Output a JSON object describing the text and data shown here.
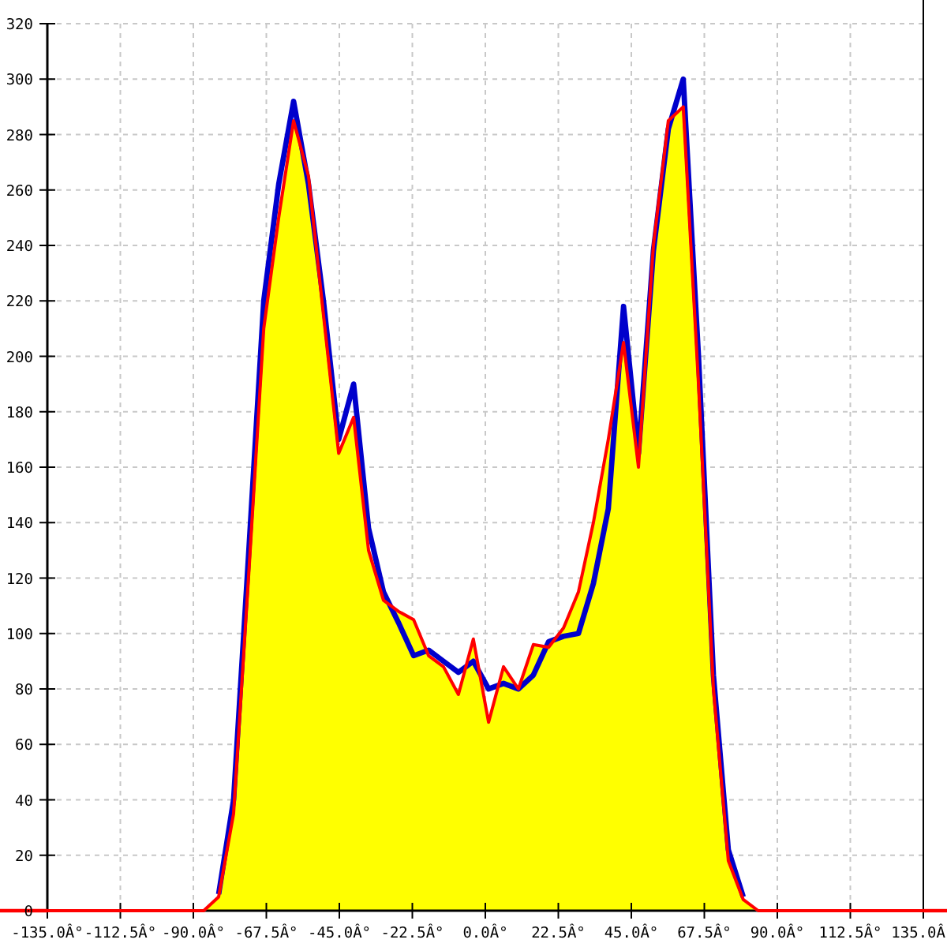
{
  "chart_data": {
    "type": "line",
    "grid": true,
    "xlim": [
      -135,
      135
    ],
    "ylim": [
      0,
      320
    ],
    "xticks": [
      {
        "value": -135,
        "label": "-135.0Â°"
      },
      {
        "value": -112.5,
        "label": "-112.5Â°"
      },
      {
        "value": -90,
        "label": "-90.0Â°"
      },
      {
        "value": -67.5,
        "label": "-67.5Â°"
      },
      {
        "value": -45,
        "label": "-45.0Â°"
      },
      {
        "value": -22.5,
        "label": "-22.5Â°"
      },
      {
        "value": 0,
        "label": "0.0Â°"
      },
      {
        "value": 22.5,
        "label": "22.5Â°"
      },
      {
        "value": 45,
        "label": "45.0Â°"
      },
      {
        "value": 67.5,
        "label": "67.5Â°"
      },
      {
        "value": 90,
        "label": "90.0Â°"
      },
      {
        "value": 112.5,
        "label": "112.5Â°"
      },
      {
        "value": 135,
        "label": "135.0Â"
      }
    ],
    "yticks": [
      0,
      20,
      40,
      60,
      80,
      100,
      120,
      140,
      160,
      180,
      200,
      220,
      240,
      260,
      280,
      300,
      320
    ],
    "x": [
      -135,
      -96.1,
      -91.4,
      -86.8,
      -82.2,
      -77.6,
      -73,
      -68.3,
      -63.7,
      -59.1,
      -54.5,
      -49.9,
      -45.2,
      -40.6,
      -36,
      -31.4,
      -26.8,
      -22.1,
      -17.5,
      -12.9,
      -8.3,
      -3.7,
      1,
      5.6,
      10.2,
      14.8,
      19.5,
      24.1,
      28.7,
      33.3,
      37.9,
      42.6,
      47.2,
      51.8,
      56.4,
      61,
      65.7,
      70.3,
      74.9,
      79.5,
      84.1,
      88.8,
      135
    ],
    "series": [
      {
        "color": "#0000cc",
        "values": [
          null,
          null,
          null,
          null,
          6,
          40,
          128,
          220,
          262,
          292,
          262,
          220,
          170,
          190,
          138,
          115,
          104,
          92,
          94,
          90,
          86,
          90,
          80,
          82,
          80,
          85,
          97,
          99,
          100,
          118,
          145,
          218,
          165,
          238,
          282,
          300,
          200,
          85,
          22,
          5,
          null,
          null,
          null
        ]
      },
      {
        "color": "#ff0000",
        "values": [
          0,
          0,
          0,
          0,
          5,
          35,
          120,
          210,
          250,
          285,
          265,
          215,
          165,
          178,
          130,
          112,
          108,
          105,
          92,
          88,
          78,
          98,
          68,
          88,
          80,
          96,
          95,
          102,
          115,
          140,
          170,
          205,
          160,
          240,
          285,
          290,
          190,
          80,
          18,
          4,
          0,
          0,
          0
        ]
      }
    ]
  }
}
